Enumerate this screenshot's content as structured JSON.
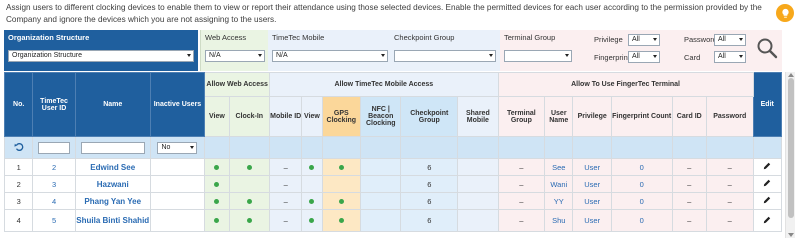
{
  "info_text": "Assign users to different clocking devices to enable them to view or report their attendance using those selected devices. Enable the permitted devices for each user according to the permission provided by the Company and ignore the devices which you are not assigning to the users.",
  "filters": {
    "org_label": "Organization Structure",
    "org_value": "Organization Structure",
    "web_label": "Web Access",
    "web_value": "N/A",
    "mobile_label": "TimeTec Mobile",
    "mobile_value": "N/A",
    "checkpoint_label": "Checkpoint Group",
    "checkpoint_value": "",
    "terminal_label": "Terminal Group",
    "terminal_value": "",
    "privilege_label": "Privilege",
    "privilege_value": "All",
    "fingerprint_label": "Fingerprint",
    "fingerprint_value": "All",
    "password_label": "Password",
    "password_value": "All",
    "card_label": "Card",
    "card_value": "All"
  },
  "table": {
    "group_headers": {
      "web": "Allow Web Access",
      "mobile": "Allow TimeTec Mobile Access",
      "finger": "Allow To Use FingerTec Terminal"
    },
    "headers": {
      "no": "No.",
      "user_id": "TimeTec User ID",
      "name": "Name",
      "inactive": "Inactive Users",
      "view": "View",
      "clock_in": "Clock-In",
      "mobile_id": "Mobile ID",
      "mview": "View",
      "gps": "GPS Clocking",
      "nfc": "NFC | Beacon Clocking",
      "checkpoint": "Checkpoint Group",
      "shared": "Shared Mobile",
      "terminal": "Terminal Group",
      "user_name": "User Name",
      "privilege": "Privilege",
      "fp_count": "Fingerprint Count",
      "card_id": "Card ID",
      "password": "Password",
      "edit": "Edit"
    },
    "inactive_filter": "No",
    "rows": [
      {
        "no": "1",
        "id": "2",
        "name": "Edwind See",
        "mobile_id": "–",
        "checkpoint": "6",
        "terminal": "–",
        "user_name": "See",
        "privilege": "User",
        "fp": "0",
        "card": "–",
        "password": "–"
      },
      {
        "no": "2",
        "id": "3",
        "name": "Hazwani",
        "mobile_id": "–",
        "checkpoint": "6",
        "terminal": "–",
        "user_name": "Wani",
        "privilege": "User",
        "fp": "0",
        "card": "–",
        "password": "–"
      },
      {
        "no": "3",
        "id": "4",
        "name": "Phang Yan Yee",
        "mobile_id": "–",
        "checkpoint": "6",
        "terminal": "–",
        "user_name": "YY",
        "privilege": "User",
        "fp": "0",
        "card": "–",
        "password": "–"
      },
      {
        "no": "4",
        "id": "5",
        "name": "Shuila Binti Shahid",
        "mobile_id": "–",
        "checkpoint": "6",
        "terminal": "–",
        "user_name": "Shu",
        "privilege": "User",
        "fp": "0",
        "card": "–",
        "password": "–"
      }
    ]
  }
}
